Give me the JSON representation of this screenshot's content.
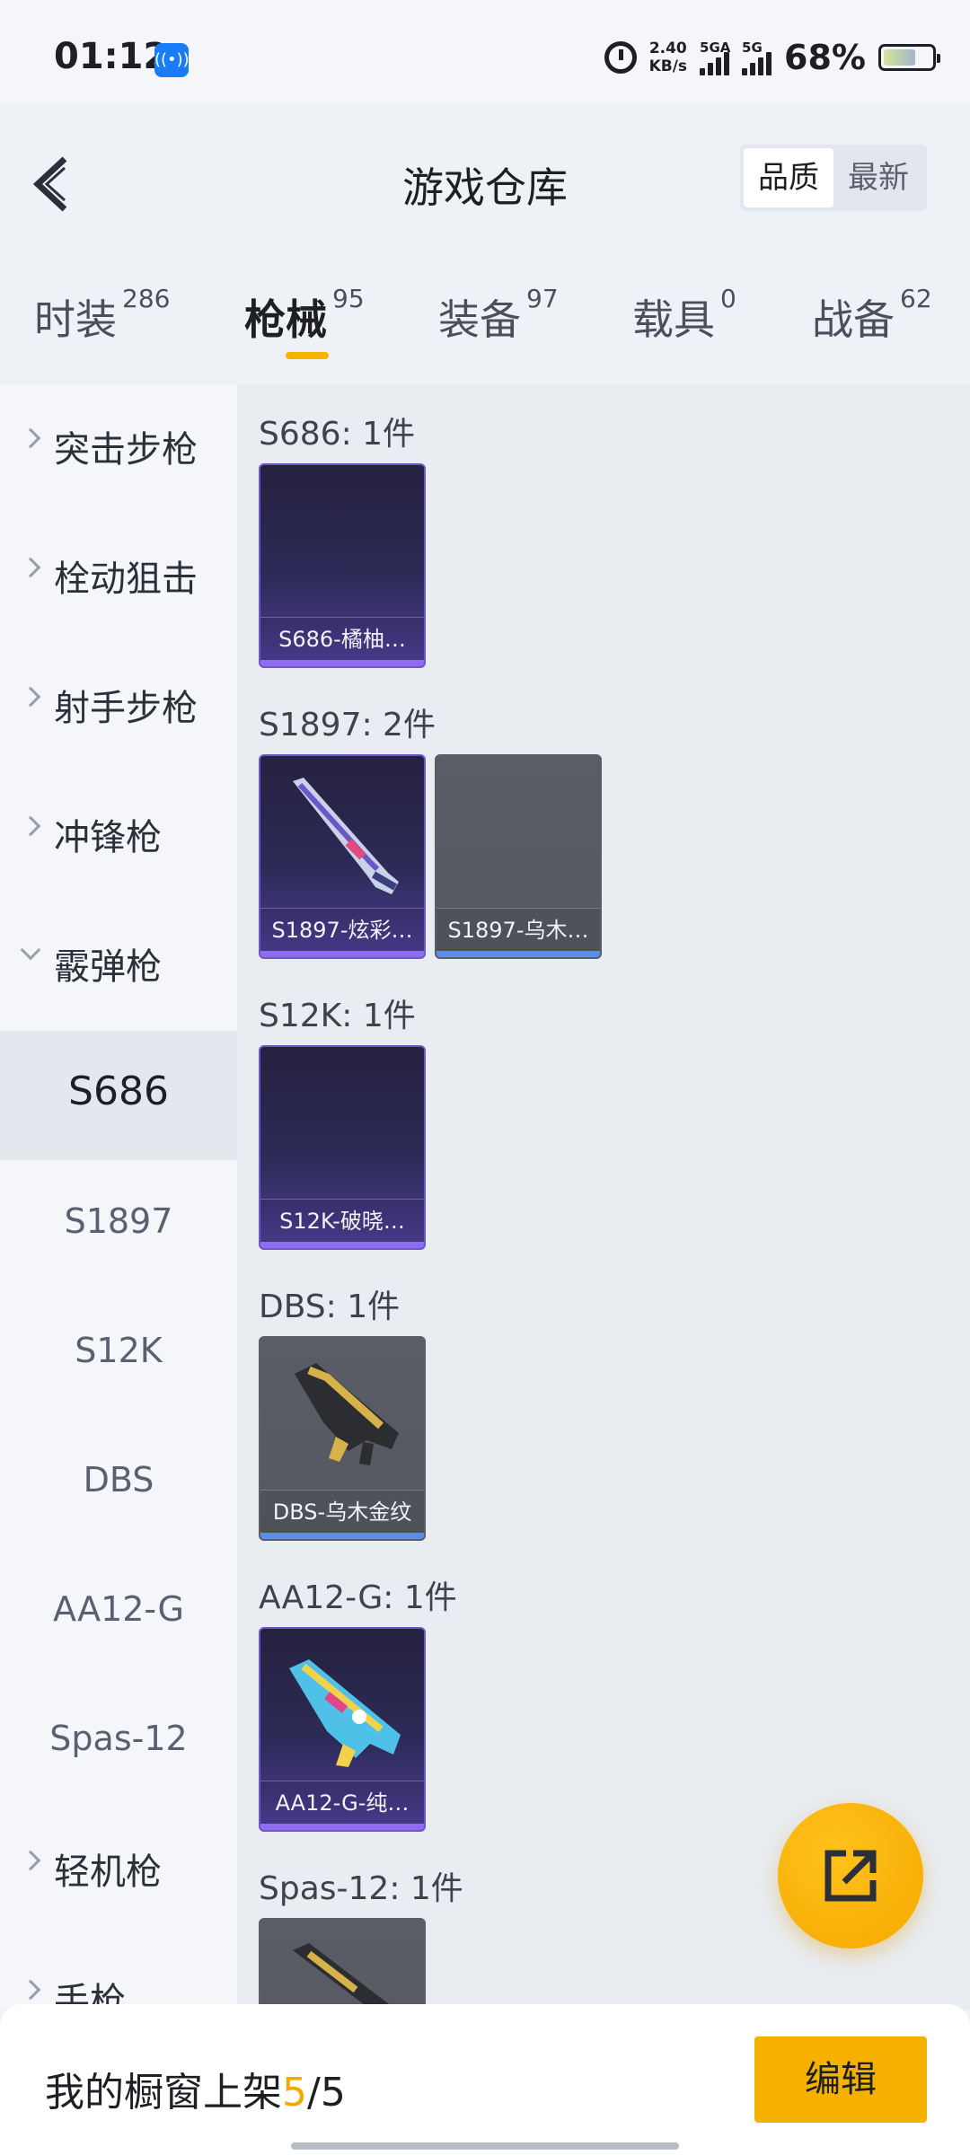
{
  "status_bar": {
    "time": "01:12",
    "net_speed_value": "2.40",
    "net_speed_unit": "KB/s",
    "sim1": "5GA",
    "sim2": "5G",
    "battery": "68%"
  },
  "header": {
    "title": "游戏仓库",
    "sort_options": [
      "品质",
      "最新"
    ],
    "sort_selected": "品质"
  },
  "tabs": [
    {
      "label": "时装",
      "count": "286"
    },
    {
      "label": "枪械",
      "count": "95",
      "active": true
    },
    {
      "label": "装备",
      "count": "97"
    },
    {
      "label": "载具",
      "count": "0"
    },
    {
      "label": "战备",
      "count": "62"
    }
  ],
  "sidebar": {
    "items": [
      {
        "type": "category",
        "label": "突击步枪"
      },
      {
        "type": "category",
        "label": "栓动狙击"
      },
      {
        "type": "category",
        "label": "射手步枪"
      },
      {
        "type": "category",
        "label": "冲锋枪"
      },
      {
        "type": "category",
        "label": "霰弹枪",
        "open": true
      },
      {
        "type": "sub",
        "label": "S686",
        "selected": true
      },
      {
        "type": "sub",
        "label": "S1897"
      },
      {
        "type": "sub",
        "label": "S12K"
      },
      {
        "type": "sub",
        "label": "DBS"
      },
      {
        "type": "sub",
        "label": "AA12-G"
      },
      {
        "type": "sub",
        "label": "Spas-12"
      },
      {
        "type": "category",
        "label": "轻机枪"
      },
      {
        "type": "category",
        "label": "手枪"
      }
    ]
  },
  "content": {
    "groups": [
      {
        "title": "S686: 1件",
        "items": [
          {
            "name": "S686-橘柚…",
            "quality": "purple",
            "image": "none"
          }
        ]
      },
      {
        "title": "S1897: 2件",
        "items": [
          {
            "name": "S1897-炫彩…",
            "quality": "purple",
            "image": "shotgun-icon"
          },
          {
            "name": "S1897-乌木…",
            "quality": "grey",
            "image": "none"
          }
        ]
      },
      {
        "title": "S12K: 1件",
        "items": [
          {
            "name": "S12K-破晓…",
            "quality": "purple",
            "image": "none"
          }
        ]
      },
      {
        "title": "DBS: 1件",
        "items": [
          {
            "name": "DBS-乌木金纹",
            "quality": "grey",
            "image": "dbs-gun-icon"
          }
        ]
      },
      {
        "title": "AA12-G: 1件",
        "items": [
          {
            "name": "AA12-G-纯…",
            "quality": "purple",
            "image": "aa12-gun-icon"
          }
        ]
      },
      {
        "title": "Spas-12: 1件",
        "items": [
          {
            "name": "",
            "quality": "grey",
            "image": "spas-gun-icon"
          }
        ]
      }
    ]
  },
  "bottom_bar": {
    "showcase_label": "我的橱窗上架",
    "showcase_current": "5",
    "showcase_total": "/5",
    "edit_label": "编辑"
  },
  "colors": {
    "accent": "#f5b000",
    "purple_quality": "#8f6cf0",
    "grey_quality": "#5b8df0"
  }
}
